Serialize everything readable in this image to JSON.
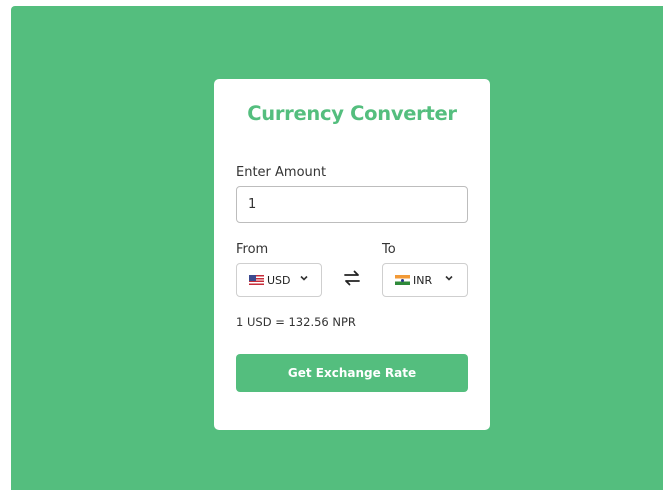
{
  "title": "Currency Converter",
  "amount": {
    "label": "Enter Amount",
    "value": "1"
  },
  "from": {
    "label": "From",
    "currency": "USD",
    "flag_icon": "us-flag-icon"
  },
  "to": {
    "label": "To",
    "currency": "INR",
    "flag_icon": "india-flag-icon"
  },
  "swap_icon": "swap-arrows-icon",
  "rate_text": "1 USD = 132.56 NPR",
  "button_label": "Get Exchange Rate",
  "colors": {
    "accent": "#54be7e",
    "card": "#ffffff",
    "text": "#333333"
  }
}
